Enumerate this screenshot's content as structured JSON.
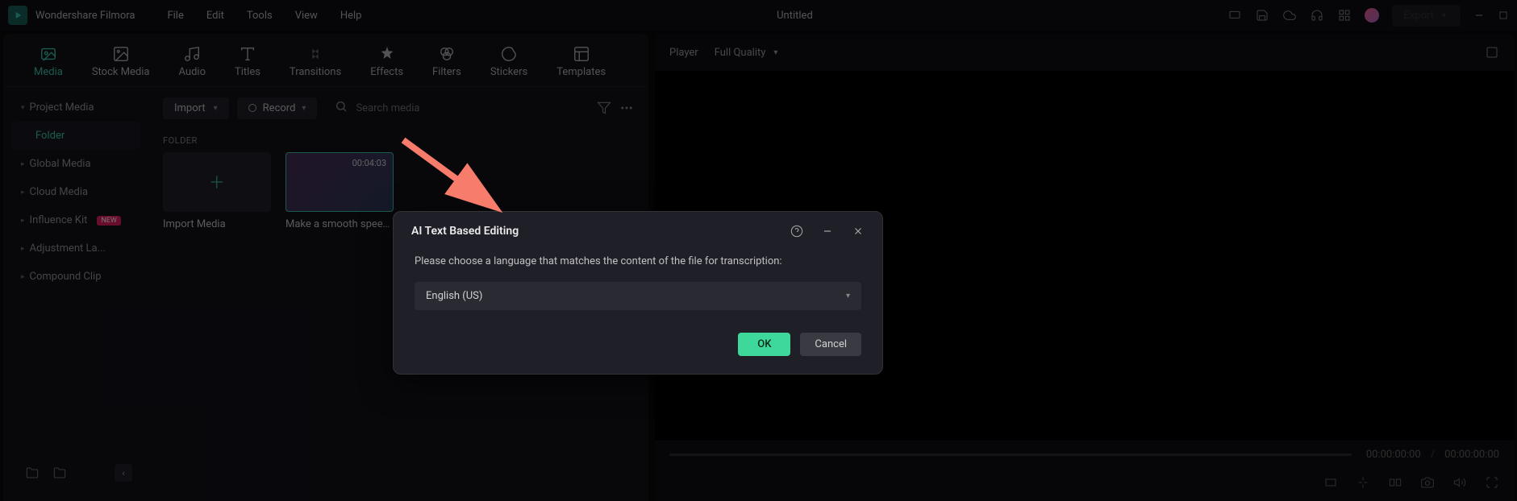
{
  "app_name": "Wondershare Filmora",
  "menu": [
    "File",
    "Edit",
    "Tools",
    "View",
    "Help"
  ],
  "document_title": "Untitled",
  "export_label": "Export",
  "tabs": [
    {
      "label": "Media",
      "active": true
    },
    {
      "label": "Stock Media"
    },
    {
      "label": "Audio"
    },
    {
      "label": "Titles"
    },
    {
      "label": "Transitions"
    },
    {
      "label": "Effects"
    },
    {
      "label": "Filters"
    },
    {
      "label": "Stickers"
    },
    {
      "label": "Templates"
    }
  ],
  "sidebar": {
    "items": [
      {
        "label": "Project Media"
      },
      {
        "label": "Folder",
        "active": true,
        "indent": true
      },
      {
        "label": "Global Media"
      },
      {
        "label": "Cloud Media"
      },
      {
        "label": "Influence Kit",
        "new_badge": "NEW"
      },
      {
        "label": "Adjustment La..."
      },
      {
        "label": "Compound Clip"
      }
    ]
  },
  "content": {
    "import_btn": "Import",
    "record_btn": "Record",
    "search_placeholder": "Search media",
    "folder_label": "FOLDER",
    "import_tile": "Import Media",
    "clip": {
      "duration": "00:04:03",
      "title": "Make a smooth speed..."
    }
  },
  "player": {
    "label": "Player",
    "quality": "Full Quality",
    "current_time": "00:00:00:00",
    "total_time": "00:00:00:00"
  },
  "modal": {
    "title": "AI Text Based Editing",
    "prompt": "Please choose a language that matches the content of the file for transcription:",
    "selected_language": "English (US)",
    "ok": "OK",
    "cancel": "Cancel"
  },
  "colors": {
    "accent": "#3dc9b0",
    "ok_btn": "#3dd89a",
    "arrow": "#f77c6b"
  }
}
